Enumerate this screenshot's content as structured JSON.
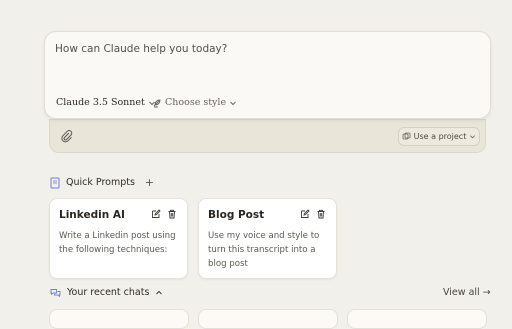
{
  "composer": {
    "placeholder": "How can Claude help you today?",
    "model_label": "Claude 3.5 Sonnet",
    "style_label": "Choose style",
    "project_label": "Use a project"
  },
  "quick_prompts": {
    "title": "Quick Prompts",
    "add": "+",
    "cards": [
      {
        "title": "Linkedin AI",
        "body": "Write a Linkedin post using the following techniques:"
      },
      {
        "title": "Blog Post",
        "body": "Use my voice and style to turn this transcript into a blog post"
      }
    ]
  },
  "recent_chats": {
    "title": "Your recent chats",
    "view_all": "View all →"
  },
  "colors": {
    "background": "#f2f0eb",
    "card": "#ffffff",
    "accent": "#6b7fd7"
  },
  "icons": [
    "book-icon",
    "chat-bubbles-icon",
    "edit-icon",
    "trash-icon",
    "paperclip-icon",
    "feather-pen-icon",
    "project-icon",
    "chevron-down-icon",
    "chevron-up-icon",
    "plus-icon"
  ]
}
